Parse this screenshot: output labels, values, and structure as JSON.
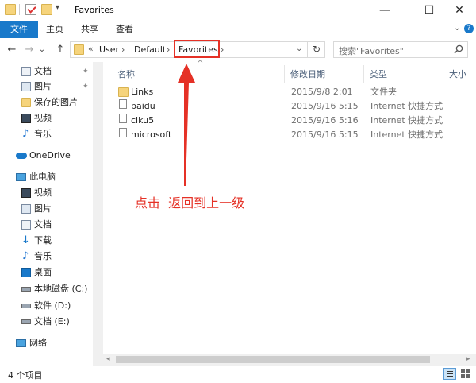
{
  "window": {
    "title": "Favorites",
    "minimize": "—",
    "maximize": "☐",
    "close": "✕"
  },
  "ribbon": {
    "tabs": [
      "文件",
      "主页",
      "共享",
      "查看"
    ]
  },
  "nav": {
    "back": "←",
    "forward": "→",
    "recent": "⌄",
    "up": "↑"
  },
  "address": {
    "overflow": "«",
    "crumbs": [
      "User",
      "Default",
      "Favorites"
    ],
    "separator": "›",
    "dropdown": "⌄",
    "refresh": "↻"
  },
  "search": {
    "placeholder": "搜索\"Favorites\"",
    "icon": "search-icon"
  },
  "columns": {
    "name": "名称",
    "date": "修改日期",
    "type": "类型",
    "size": "大小"
  },
  "files": [
    {
      "name": "Links",
      "date": "2015/9/8 2:01",
      "type": "文件夹",
      "icon": "folder-icon"
    },
    {
      "name": "baidu",
      "date": "2015/9/16 5:15",
      "type": "Internet 快捷方式",
      "icon": "shortcut-icon"
    },
    {
      "name": "ciku5",
      "date": "2015/9/16 5:16",
      "type": "Internet 快捷方式",
      "icon": "shortcut-icon"
    },
    {
      "name": "microsoft",
      "date": "2015/9/16 5:15",
      "type": "Internet 快捷方式",
      "icon": "shortcut-icon"
    }
  ],
  "sidebar": {
    "quick_access": [
      "文档",
      "图片",
      "保存的图片",
      "视频",
      "音乐"
    ],
    "onedrive": "OneDrive",
    "this_pc": "此电脑",
    "pc_items": [
      "视频",
      "图片",
      "文档",
      "下载",
      "音乐",
      "桌面",
      "本地磁盘 (C:)",
      "软件 (D:)",
      "文档 (E:)"
    ],
    "network": "网络"
  },
  "annotation": {
    "text": "点击  返回到上一级",
    "color": "#e53126"
  },
  "status": {
    "item_count": "4 个项目"
  },
  "colors": {
    "accent": "#1979ca",
    "annotation": "#e53126"
  }
}
